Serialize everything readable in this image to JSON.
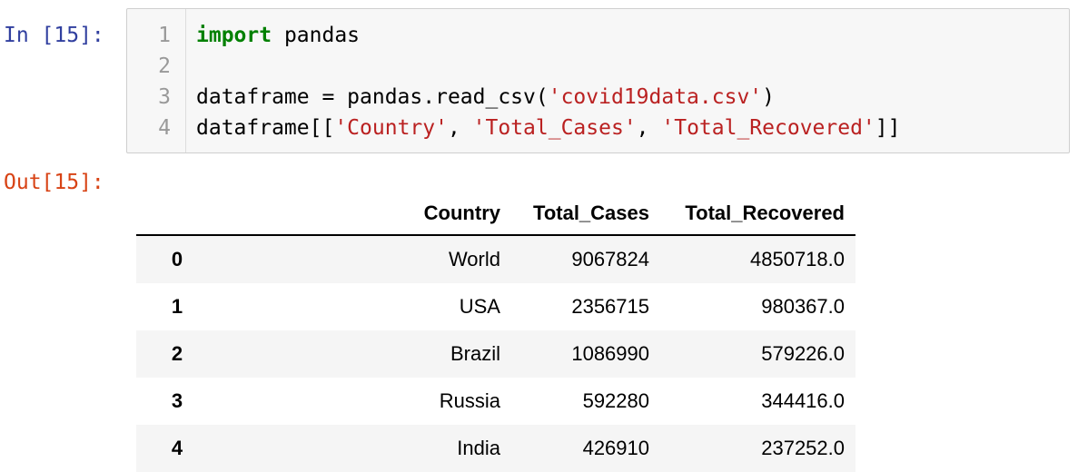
{
  "in_prompt": "In [15]:",
  "out_prompt": "Out[15]:",
  "code": {
    "line_numbers": [
      "1",
      "2",
      "3",
      "4"
    ],
    "line1": {
      "keyword": "import",
      "rest": " pandas"
    },
    "line3": {
      "prefix": "dataframe = pandas.read_csv(",
      "str": "'covid19data.csv'",
      "suffix": ")"
    },
    "line4": {
      "prefix": "dataframe[[",
      "str1": "'Country'",
      "sep1": ", ",
      "str2": "'Total_Cases'",
      "sep2": ", ",
      "str3": "'Total_Recovered'",
      "suffix": "]]"
    }
  },
  "table": {
    "columns": [
      "",
      "Country",
      "Total_Cases",
      "Total_Recovered"
    ],
    "rows": [
      {
        "index": "0",
        "country": "World",
        "total_cases": "9067824",
        "total_recovered": "4850718.0"
      },
      {
        "index": "1",
        "country": "USA",
        "total_cases": "2356715",
        "total_recovered": "980367.0"
      },
      {
        "index": "2",
        "country": "Brazil",
        "total_cases": "1086990",
        "total_recovered": "579226.0"
      },
      {
        "index": "3",
        "country": "Russia",
        "total_cases": "592280",
        "total_recovered": "344416.0"
      },
      {
        "index": "4",
        "country": "India",
        "total_cases": "426910",
        "total_recovered": "237252.0"
      }
    ]
  }
}
